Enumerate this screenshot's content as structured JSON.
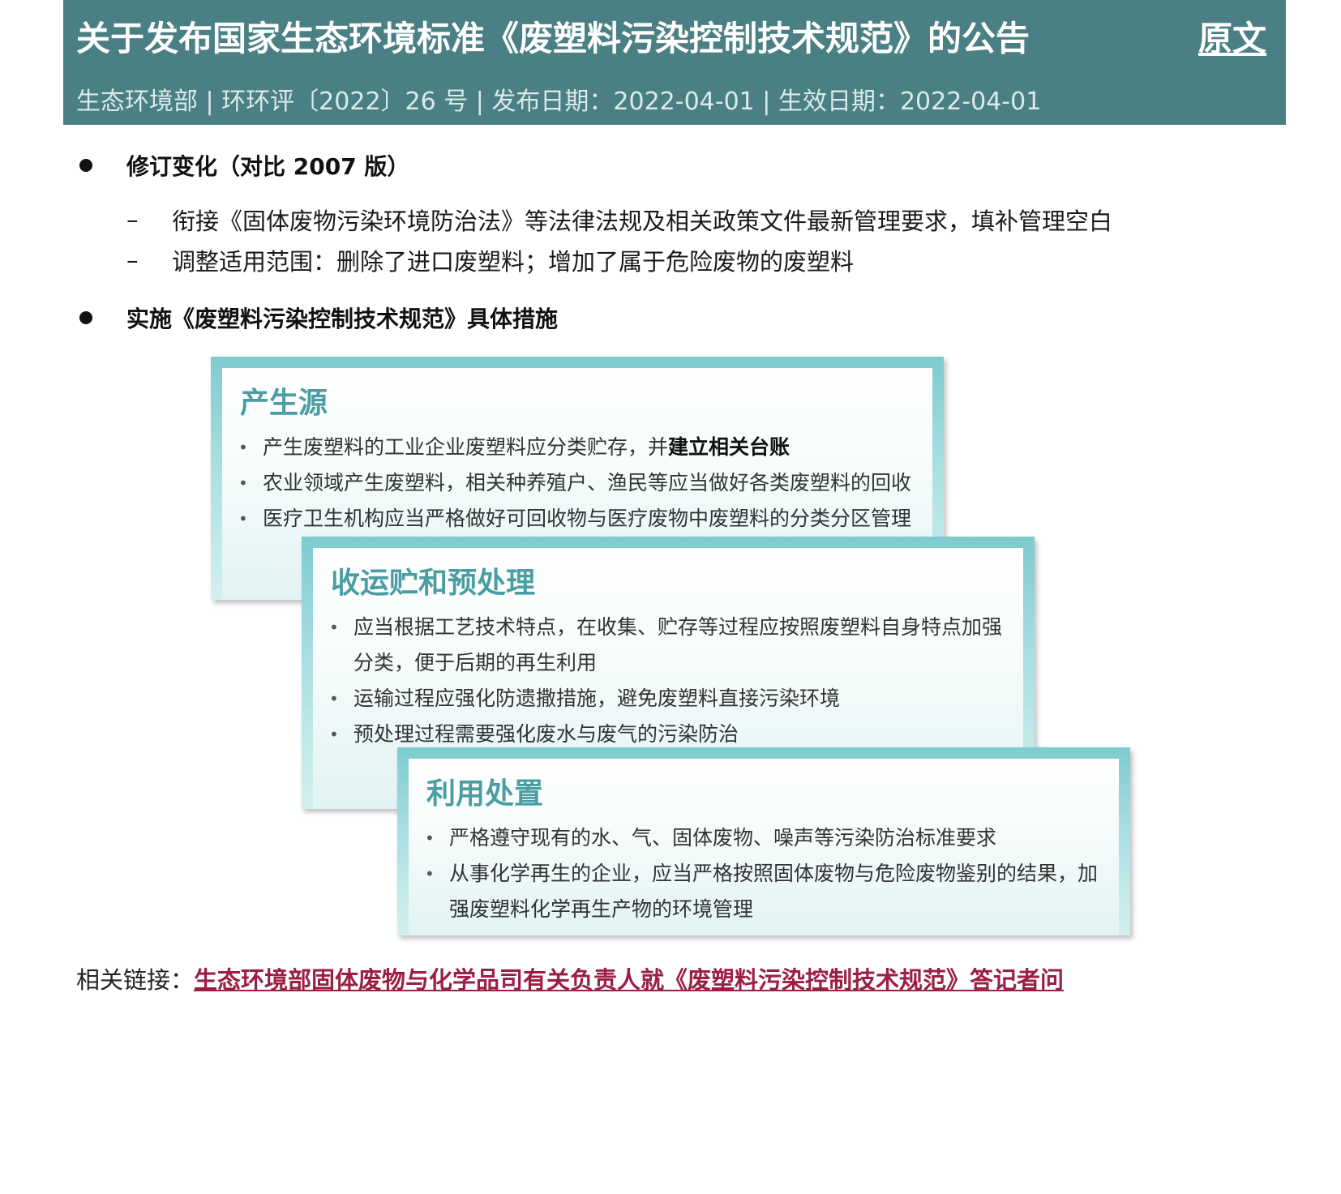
{
  "header": {
    "title": "关于发布国家生态环境标准《废塑料污染控制技术规范》的公告",
    "original_link": "原文",
    "meta": "生态环境部 | 环环评〔2022〕26 号 | 发布日期：2022-04-01 | 生效日期：2022-04-01"
  },
  "section1": {
    "heading": "修订变化（对比 2007 版）",
    "items": [
      "衔接《固体废物污染环境防治法》等法律法规及相关政策文件最新管理要求，填补管理空白",
      "调整适用范围：删除了进口废塑料；增加了属于危险废物的废塑料"
    ]
  },
  "section2": {
    "heading": "实施《废塑料污染控制技术规范》具体措施"
  },
  "cards": [
    {
      "title": "产生源",
      "items": [
        {
          "text": "产生废塑料的工业企业废塑料应分类贮存，并",
          "bold": "建立相关台账"
        },
        {
          "text": "农业领域产生废塑料，相关种养殖户、渔民等应当做好各类废塑料的回收",
          "bold": ""
        },
        {
          "text": "医疗卫生机构应当严格做好可回收物与医疗废物中废塑料的分类分区管理",
          "bold": ""
        }
      ]
    },
    {
      "title": "收运贮和预处理",
      "items": [
        {
          "text": "应当根据工艺技术特点，在收集、贮存等过程应按照废塑料自身特点加强分类，便于后期的再生利用",
          "bold": ""
        },
        {
          "text": "运输过程应强化防遗撒措施，避免废塑料直接污染环境",
          "bold": ""
        },
        {
          "text": "预处理过程需要强化废水与废气的污染防治",
          "bold": ""
        }
      ]
    },
    {
      "title": "利用处置",
      "items": [
        {
          "text": "严格遵守现有的水、气、固体废物、噪声等污染防治标准要求",
          "bold": ""
        },
        {
          "text": "从事化学再生的企业，应当严格按照固体废物与危险废物鉴别的结果，加强废塑料化学再生产物的环境管理",
          "bold": ""
        }
      ]
    }
  ],
  "related": {
    "label": "相关链接：",
    "link_text": "生态环境部固体废物与化学品司有关负责人就《废塑料污染控制技术规范》答记者问"
  }
}
